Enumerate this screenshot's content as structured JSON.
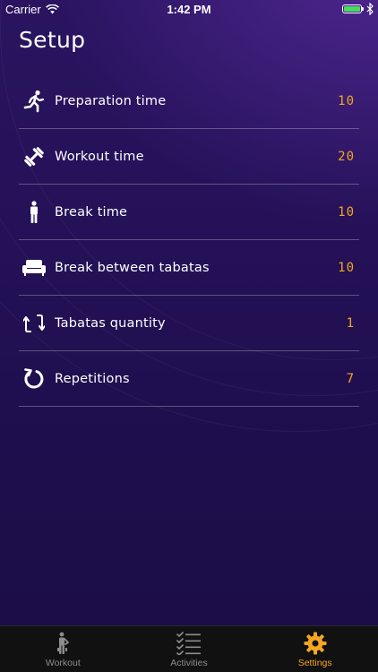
{
  "status_bar": {
    "carrier": "Carrier",
    "time": "1:42 PM"
  },
  "page": {
    "title": "Setup"
  },
  "settings": [
    {
      "label": "Preparation time",
      "value": "10",
      "icon": "running-person-icon"
    },
    {
      "label": "Workout time",
      "value": "20",
      "icon": "dumbbell-icon"
    },
    {
      "label": "Break time",
      "value": "10",
      "icon": "standing-person-icon"
    },
    {
      "label": "Break between tabatas",
      "value": "10",
      "icon": "sofa-icon"
    },
    {
      "label": "Tabatas quantity",
      "value": "1",
      "icon": "repeat-arrows-icon"
    },
    {
      "label": "Repetitions",
      "value": "7",
      "icon": "refresh-circle-icon"
    }
  ],
  "tab_bar": {
    "tabs": [
      {
        "label": "Workout",
        "icon": "workout-person-icon",
        "active": false
      },
      {
        "label": "Activities",
        "icon": "checklist-icon",
        "active": false
      },
      {
        "label": "Settings",
        "icon": "gear-icon",
        "active": true
      }
    ]
  },
  "colors": {
    "accent": "#f6a623",
    "background_top": "#2a1460",
    "background_bottom": "#1b0d46",
    "tab_bar": "#111111",
    "battery": "#4cd964"
  }
}
